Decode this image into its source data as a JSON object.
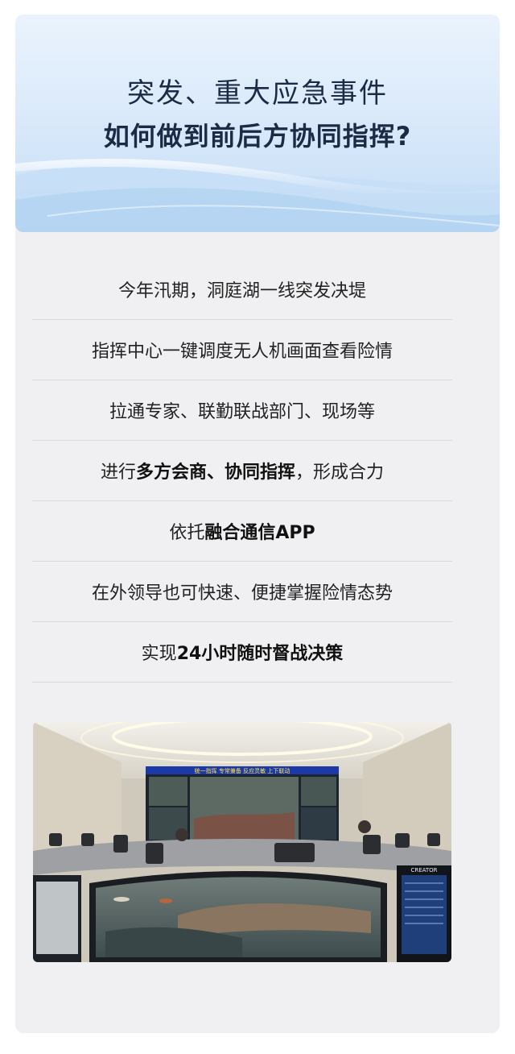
{
  "header": {
    "title_line1": "突发、重大应急事件",
    "title_line2": "如何做到前后方协同指挥?"
  },
  "list": [
    {
      "parts": [
        {
          "text": "今年汛期，洞庭湖一线突发决堤",
          "bold": false
        }
      ]
    },
    {
      "parts": [
        {
          "text": "指挥中心一键调度无人机画面查看险情",
          "bold": false
        }
      ]
    },
    {
      "parts": [
        {
          "text": "拉通专家、联勤联战部门、现场等",
          "bold": false
        }
      ]
    },
    {
      "parts": [
        {
          "text": "进行",
          "bold": false
        },
        {
          "text": "多方会商、协同指挥",
          "bold": true
        },
        {
          "text": "，形成合力",
          "bold": false
        }
      ]
    },
    {
      "parts": [
        {
          "text": "依托",
          "bold": false
        },
        {
          "text": "融合通信APP",
          "bold": true
        }
      ]
    },
    {
      "parts": [
        {
          "text": "在外领导也可快速、便捷掌握险情态势",
          "bold": false
        }
      ]
    },
    {
      "parts": [
        {
          "text": "实现",
          "bold": false
        },
        {
          "text": "24小时随时督战决策",
          "bold": true
        }
      ]
    }
  ],
  "photo": {
    "wall_banner": "统一指挥  专常兼备  反应灵敏  上下联动",
    "monitor_brand": "CREATOR"
  },
  "colors": {
    "title": "#1b2b45",
    "card_bg": "#f0f0f2",
    "banner_top": "#eaf3fd",
    "banner_bottom": "#bcd8f3"
  }
}
